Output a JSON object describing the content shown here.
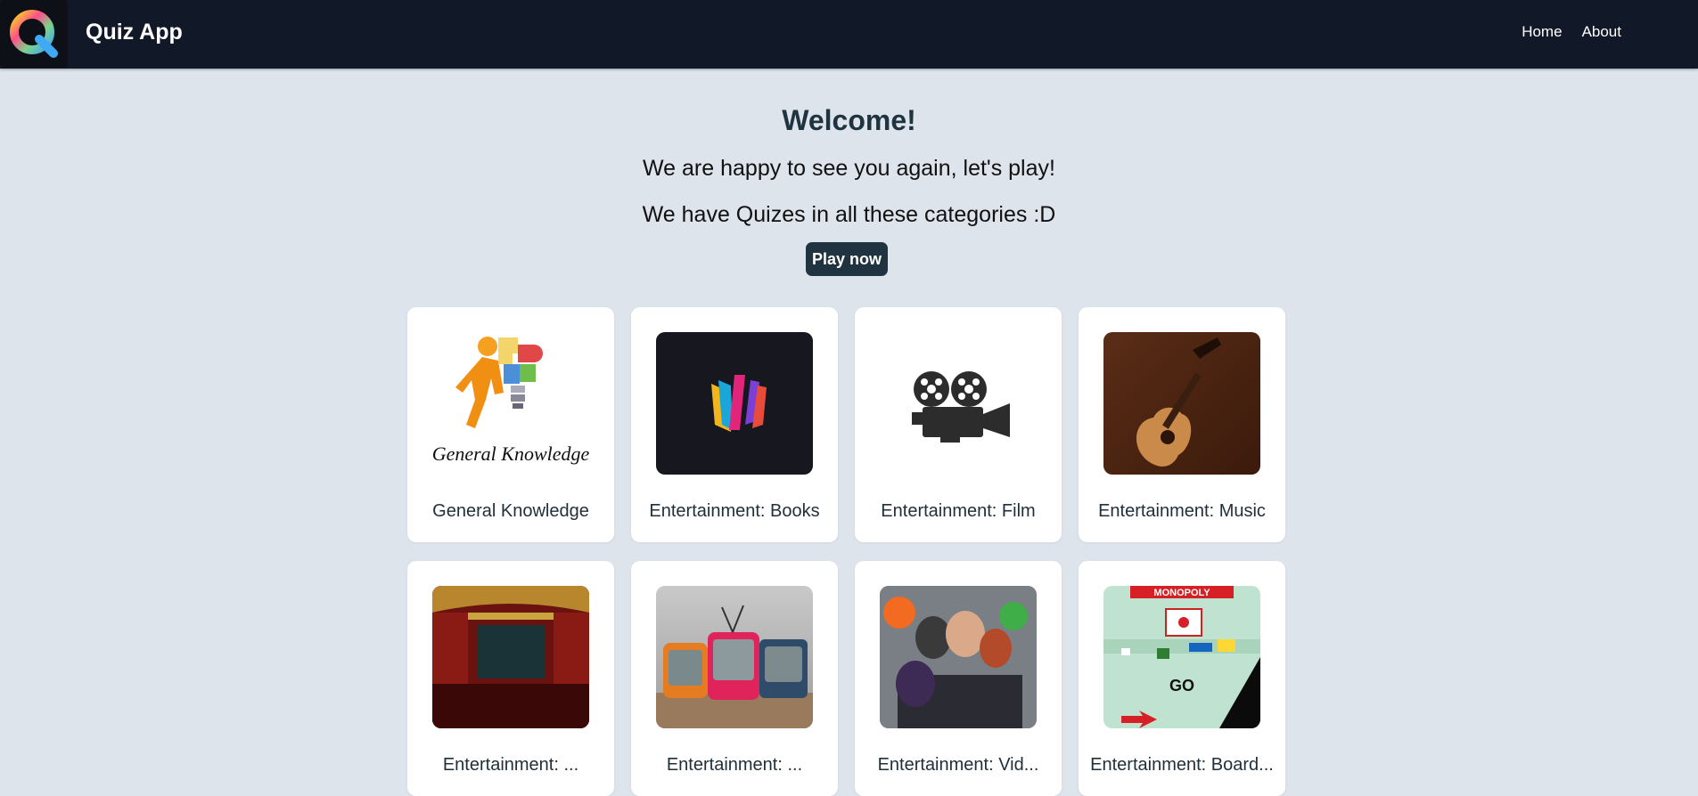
{
  "navbar": {
    "brand": "Quiz App",
    "links": [
      "Home",
      "About"
    ],
    "logo_icon": "q-logo-icon"
  },
  "hero": {
    "title": "Welcome!",
    "line1": "We are happy to see you again, let's play!",
    "line2": "We have Quizes in all these categories :D",
    "play_label": "Play now"
  },
  "categories": [
    {
      "label": "General Knowledge",
      "icon": "general-knowledge-image"
    },
    {
      "label": "Entertainment: Books",
      "icon": "books-image"
    },
    {
      "label": "Entertainment: Film",
      "icon": "film-projector-image"
    },
    {
      "label": "Entertainment: Music",
      "icon": "guitar-image"
    },
    {
      "label": "Entertainment: ...",
      "icon": "theatre-image"
    },
    {
      "label": "Entertainment: ...",
      "icon": "tv-image"
    },
    {
      "label": "Entertainment: Vid...",
      "icon": "video-game-characters-image"
    },
    {
      "label": "Entertainment: Board...",
      "icon": "board-game-image"
    }
  ],
  "card_images": {
    "gk_caption": "General Knowledge",
    "board_text_top": "MONOPOLY",
    "board_text_go": "GO"
  },
  "colors": {
    "navbar": "#111827",
    "background": "#dee4ec",
    "accent": "#1f3440",
    "card": "#ffffff"
  }
}
